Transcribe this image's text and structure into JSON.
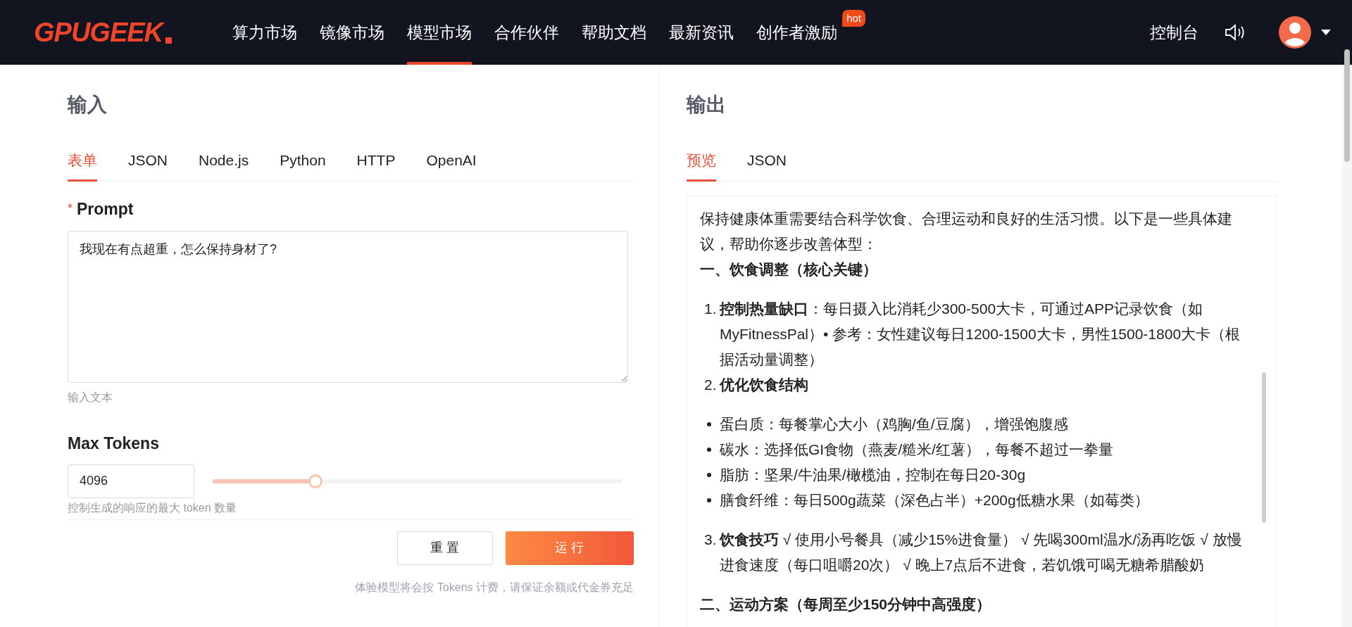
{
  "header": {
    "logo": "GPUGEEK",
    "nav": [
      {
        "label": "算力市场",
        "selected": false
      },
      {
        "label": "镜像市场",
        "selected": false
      },
      {
        "label": "模型市场",
        "selected": true
      },
      {
        "label": "合作伙伴",
        "selected": false
      },
      {
        "label": "帮助文档",
        "selected": false
      },
      {
        "label": "最新资讯",
        "selected": false
      },
      {
        "label": "创作者激励",
        "selected": false,
        "badge": "hot"
      }
    ],
    "console": "控制台"
  },
  "input": {
    "title": "输入",
    "tabs": [
      {
        "label": "表单",
        "selected": true
      },
      {
        "label": "JSON",
        "selected": false
      },
      {
        "label": "Node.js",
        "selected": false
      },
      {
        "label": "Python",
        "selected": false
      },
      {
        "label": "HTTP",
        "selected": false
      },
      {
        "label": "OpenAI",
        "selected": false
      }
    ],
    "prompt": {
      "required_mark": "*",
      "label": "Prompt",
      "value": "我现在有点超重，怎么保持身材了?",
      "hint": "输入文本"
    },
    "max_tokens": {
      "label": "Max Tokens",
      "value": "4096",
      "level": 0.25,
      "hint": "控制生成的响应的最大 token 数量"
    },
    "buttons": {
      "reset": "重 置",
      "run": "运 行"
    },
    "note": "体验模型将会按 Tokens 计费，请保证余额或代金券充足"
  },
  "output": {
    "title": "输出",
    "tabs": [
      {
        "label": "预览",
        "selected": true
      },
      {
        "label": "JSON",
        "selected": false
      }
    ],
    "blocks": [
      {
        "kind": "paragraph",
        "text": "保持健康体重需要结合科学饮食、合理运动和良好的生活习惯。以下是一些具体建议，帮助你逐步改善体型："
      },
      {
        "kind": "heading",
        "text": "一、饮食调整（核心关键）"
      },
      {
        "kind": "numbered",
        "number": "1.",
        "text": "**控制热量缺口**：每日摄入比消耗少300-500大卡，可通过APP记录饮食（如MyFitnessPal）• 参考：女性建议每日1200-1500大卡，男性1500-1800大卡（根据活动量调整）"
      },
      {
        "kind": "numbered",
        "number": "2.",
        "text": "**优化饮食结构**"
      },
      {
        "kind": "bullet",
        "text": "蛋白质：每餐掌心大小（鸡胸/鱼/豆腐），增强饱腹感"
      },
      {
        "kind": "bullet",
        "text": "碳水：选择低GI食物（燕麦/糙米/红薯），每餐不超过一拳量"
      },
      {
        "kind": "bullet",
        "text": "脂肪：坚果/牛油果/橄榄油，控制在每日20-30g"
      },
      {
        "kind": "bullet",
        "text": "膳食纤维：每日500g蔬菜（深色占半）+200g低糖水果（如莓类）"
      },
      {
        "kind": "numbered",
        "number": "3.",
        "text": "**饮食技巧** √ 使用小号餐具（减少15%进食量） √ 先喝300ml温水/汤再吃饭 √ 放慢进食速度（每口咀嚼20次） √ 晚上7点后不进食，若饥饿可喝无糖希腊酸奶"
      },
      {
        "kind": "heading",
        "text": "二、运动方案（每周至少150分钟中高强度）"
      }
    ]
  }
}
